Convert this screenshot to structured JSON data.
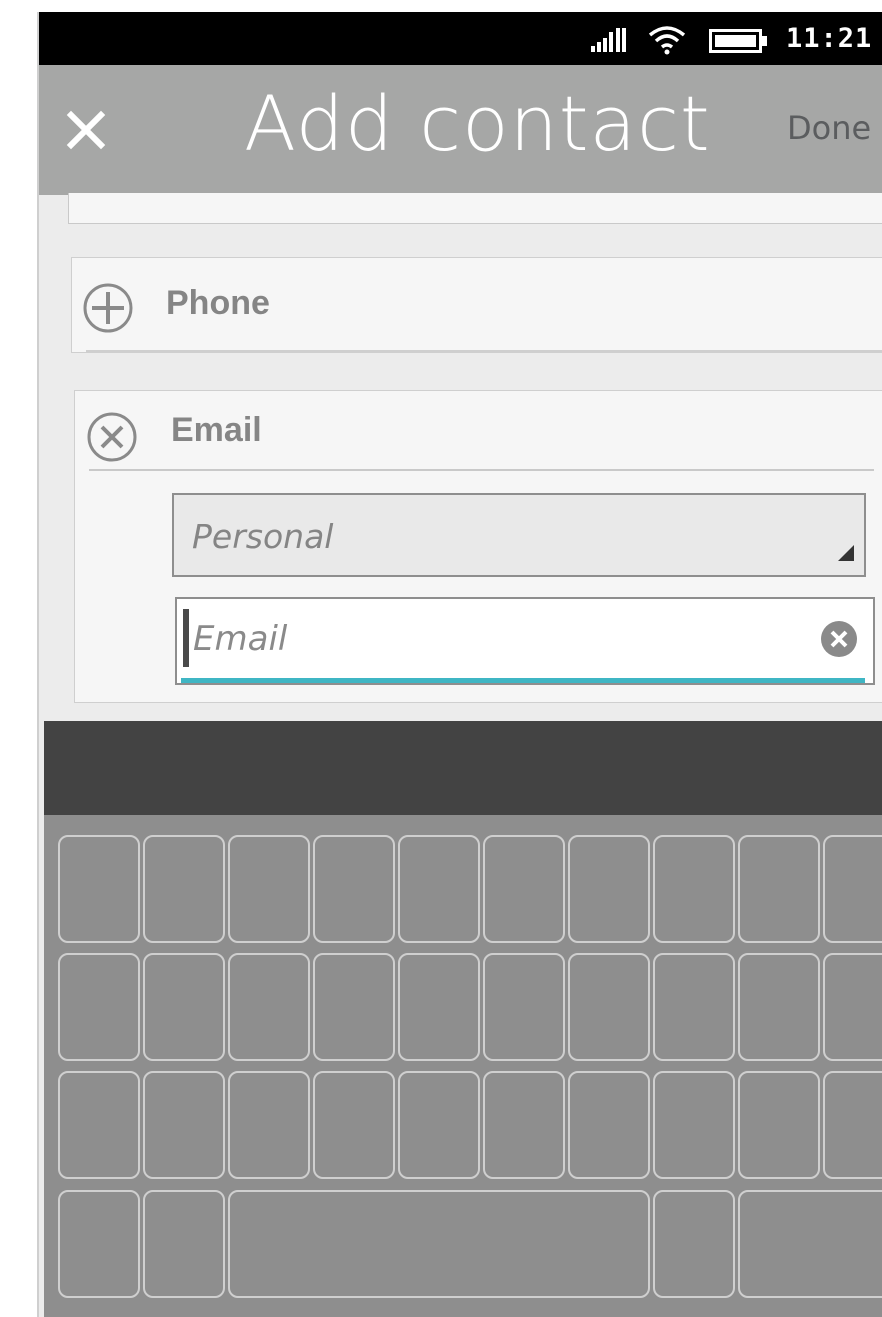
{
  "status_bar": {
    "time": "11:21 pm",
    "signal_icon": "signal-icon",
    "wifi_icon": "wifi-icon",
    "battery_icon": "battery-icon"
  },
  "header": {
    "title": "Add contact",
    "close_icon": "close-icon",
    "done_label": "Done"
  },
  "sections": {
    "phone": {
      "label": "Phone",
      "icon": "add-circle-icon"
    },
    "email": {
      "label": "Email",
      "icon": "remove-circle-icon",
      "type_value": "Personal",
      "input_value": "",
      "input_placeholder": "Email",
      "clear_icon": "clear-icon"
    }
  },
  "keyboard": {
    "rows": [
      10,
      10,
      10,
      5
    ]
  },
  "colors": {
    "header_bg": "#a6a7a6",
    "accent": "#3fb6c4",
    "status_bar_bg": "#000000",
    "keyboard_bg": "#8e8e8e",
    "keyboard_bar_bg": "#434343"
  }
}
